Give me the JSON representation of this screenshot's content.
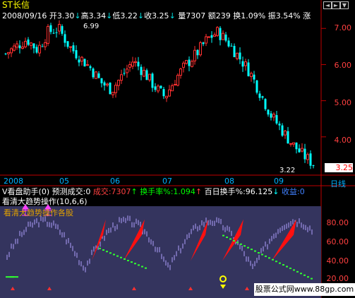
{
  "header": {
    "stock_name": "ST长信",
    "date": "2008/09/16",
    "open_label": "开",
    "open_value": "3.30",
    "open_arrow": "↓",
    "high_label": "高",
    "high_value": "3.34",
    "high_arrow": "↓",
    "low_label": "低",
    "low_value": "3.22",
    "low_arrow": "↓",
    "close_label": "收",
    "close_value": "3.25",
    "close_arrow": "↓",
    "volume_label": "量",
    "volume_value": "7307",
    "amount_label": "额",
    "amount_value": "239",
    "turnover_label": "换",
    "turnover_value": "1.09%",
    "amplitude_label": "振",
    "amplitude_value": "3.54%",
    "trailing": "涨"
  },
  "price_axis": {
    "labels": [
      "7.00",
      "6.00",
      "5.00",
      "4.00"
    ],
    "current_price": "3.25",
    "high_mark": "6.99",
    "low_mark": "3.22"
  },
  "date_axis": {
    "labels": [
      "2008",
      "05",
      "06",
      "07",
      "08",
      "09"
    ],
    "period": "日线"
  },
  "indicator1": {
    "name": "V看盘助手",
    "params": "(0)",
    "forecast_label": "预测成交",
    "forecast_value": ":0",
    "volume_label": "成交",
    "volume_value": ":7307",
    "turnover_label": "换手率%",
    "turnover_value": ":1.094",
    "turnover_arrow": "↑",
    "hundred_label": "百日换手%",
    "hundred_value": ":96.125",
    "hundred_arrow": "↓",
    "profit_label": "收益",
    "profit_value": ":0"
  },
  "indicator2": {
    "name": "看清大趋势操作",
    "params": "(10,6,6)",
    "subtitle": "看清大趋势操作各股"
  },
  "osc_axis": {
    "labels": [
      "80.00",
      "60.00",
      "40.00",
      "20.00"
    ]
  },
  "watermark": {
    "text": "股票公式网www.88gp.com"
  },
  "colors": {
    "up": "#ff3030",
    "down": "#00ffff",
    "axis": "#ff0000",
    "osc_bg": "#3a3a6a"
  },
  "chart_data": {
    "type": "candlestick",
    "title": "ST长信",
    "dates": [
      "2008",
      "05",
      "06",
      "07",
      "08",
      "09"
    ],
    "ylim": [
      3.0,
      7.2
    ],
    "high": 6.99,
    "low": 3.22,
    "last": 3.25,
    "closes": [
      6.3,
      6.5,
      6.7,
      6.4,
      6.9,
      6.99,
      6.5,
      6.2,
      5.9,
      5.5,
      5.3,
      5.7,
      6.1,
      5.8,
      5.4,
      5.1,
      5.6,
      6.0,
      6.3,
      6.7,
      6.9,
      6.6,
      6.2,
      5.8,
      5.2,
      4.6,
      4.2,
      3.8,
      3.5,
      3.25
    ]
  }
}
